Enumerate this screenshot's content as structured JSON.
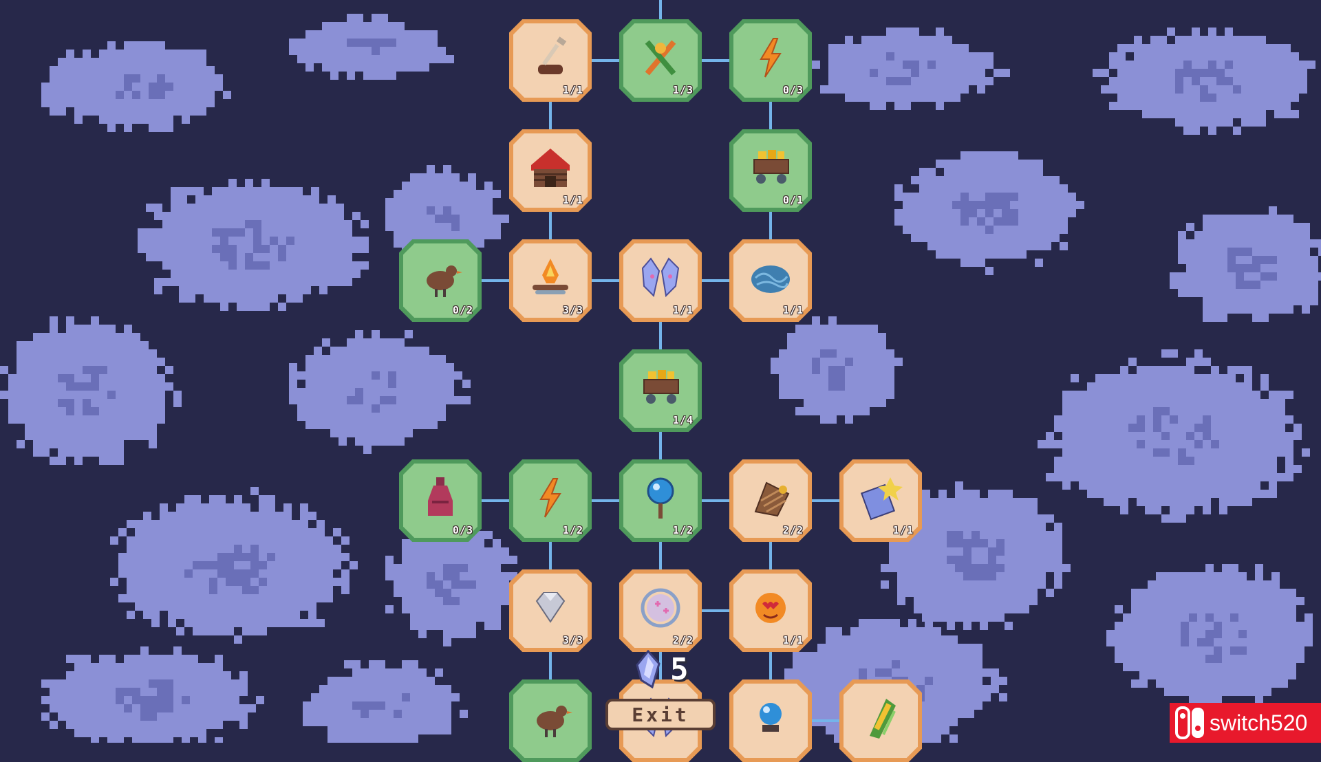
{
  "colors": {
    "background": "#27284a",
    "cloud": "#8b90d6",
    "cloud_shadow": "#6a6fb8",
    "connector": "#74b4ea",
    "node_orange_border": "#e79a55",
    "node_orange_fill": "#f3d2b2",
    "node_green_border": "#4f9a5c",
    "node_green_fill": "#8fcb8c"
  },
  "nodes": [
    {
      "id": "shovel",
      "icon": "shovel-icon",
      "style": "orange",
      "count": "1/1"
    },
    {
      "id": "crossed-tools",
      "icon": "crossed-tools-icon",
      "style": "green",
      "count": "1/3"
    },
    {
      "id": "lightning-top",
      "icon": "lightning-icon",
      "style": "green",
      "count": "0/3"
    },
    {
      "id": "storehouse",
      "icon": "storehouse-icon",
      "style": "orange",
      "count": "1/1"
    },
    {
      "id": "gold-cart-top",
      "icon": "gold-cart-icon",
      "style": "green",
      "count": "0/1"
    },
    {
      "id": "chicken-top",
      "icon": "chicken-icon",
      "style": "green",
      "count": "0/2"
    },
    {
      "id": "campfire",
      "icon": "campfire-icon",
      "style": "orange",
      "count": "3/3"
    },
    {
      "id": "crystal-shards",
      "icon": "crystal-shards-icon",
      "style": "orange",
      "count": "1/1"
    },
    {
      "id": "brain",
      "icon": "brain-icon",
      "style": "orange",
      "count": "1/1"
    },
    {
      "id": "gold-cart-mid",
      "icon": "gold-cart-icon",
      "style": "green",
      "count": "1/4"
    },
    {
      "id": "potion",
      "icon": "potion-bottle-icon",
      "style": "green",
      "count": "0/3"
    },
    {
      "id": "lightning-mid",
      "icon": "lightning-icon",
      "style": "green",
      "count": "1/2"
    },
    {
      "id": "magic-mirror",
      "icon": "magic-mirror-icon",
      "style": "green",
      "count": "1/2"
    },
    {
      "id": "glove",
      "icon": "glove-icon",
      "style": "orange",
      "count": "2/2"
    },
    {
      "id": "map-scroll",
      "icon": "map-scroll-icon",
      "style": "orange",
      "count": "1/1"
    },
    {
      "id": "diamond",
      "icon": "diamond-icon",
      "style": "orange",
      "count": "3/3"
    },
    {
      "id": "magic-ring",
      "icon": "magic-ring-icon",
      "style": "orange",
      "count": "2/2"
    },
    {
      "id": "heart-face",
      "icon": "heart-face-icon",
      "style": "orange",
      "count": "1/1"
    },
    {
      "id": "chicken-bottom",
      "icon": "chicken-icon",
      "style": "green",
      "count": ""
    },
    {
      "id": "hidden-bottom",
      "icon": "crystal-shards-icon",
      "style": "orange",
      "count": ""
    },
    {
      "id": "blue-orb",
      "icon": "blue-orb-icon",
      "style": "orange",
      "count": ""
    },
    {
      "id": "corn",
      "icon": "corn-icon",
      "style": "orange",
      "count": ""
    }
  ],
  "skill_points": {
    "icon": "crystal-shard-icon",
    "value": "5"
  },
  "exit_label": "Exit",
  "watermark": {
    "icon": "switch-logo-icon",
    "text": "switch520"
  }
}
